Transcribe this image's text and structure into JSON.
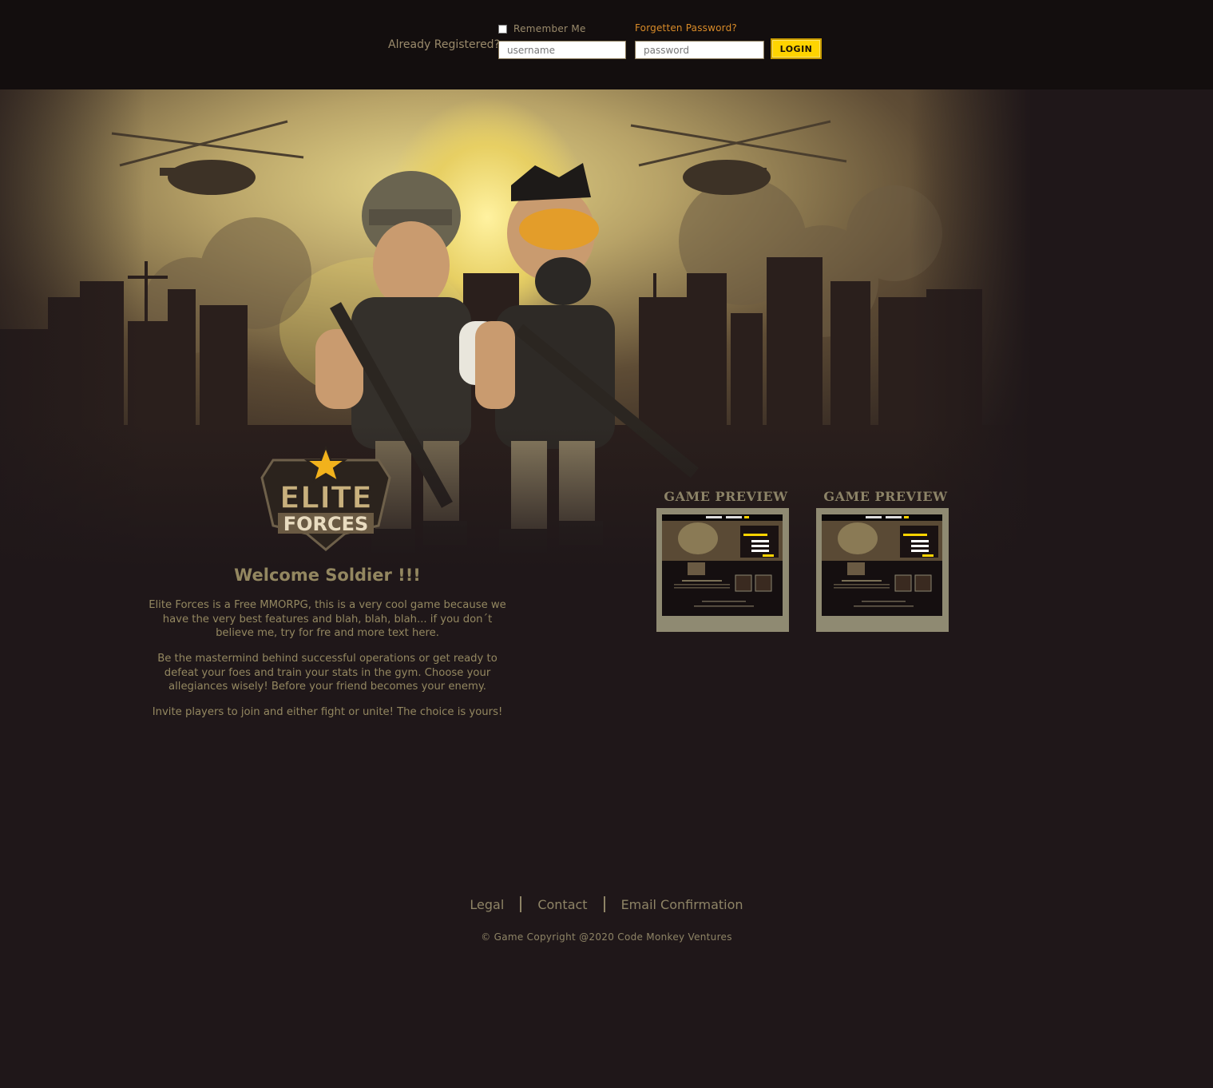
{
  "login_bar": {
    "already_registered": "Already Registered?",
    "remember_me": "Remember Me",
    "forgot_password": "Forgetten Password?",
    "username_placeholder": "username",
    "password_placeholder": "password",
    "login_label": "LOGIN"
  },
  "logo": {
    "line1": "ELITE",
    "line2": "FORCES"
  },
  "welcome": {
    "title": "Welcome Soldier !!!",
    "paragraphs": [
      "Elite Forces is a Free MMORPG, this is a very cool game because we have the very best features and blah, blah, blah... if you don´t believe me, try for fre and more text here.",
      "Be the mastermind behind successful operations or get ready to defeat your foes and train your stats in the gym. Choose your allegiances wisely! Before your friend becomes your enemy.",
      "Invite players to join and either fight or unite! The choice is yours!"
    ]
  },
  "previews": [
    {
      "title": "GAME PREVIEW"
    },
    {
      "title": "GAME PREVIEW"
    }
  ],
  "footer": {
    "links": [
      "Legal",
      "Contact",
      "Email Confirmation"
    ],
    "copyright": "© Game Copyright @2020 Code Monkey Ventures"
  },
  "colors": {
    "background": "#1f1719",
    "topbar": "#130e0e",
    "text": "#938760",
    "accent_link": "#d98b28",
    "login_button": "#ffd400"
  }
}
